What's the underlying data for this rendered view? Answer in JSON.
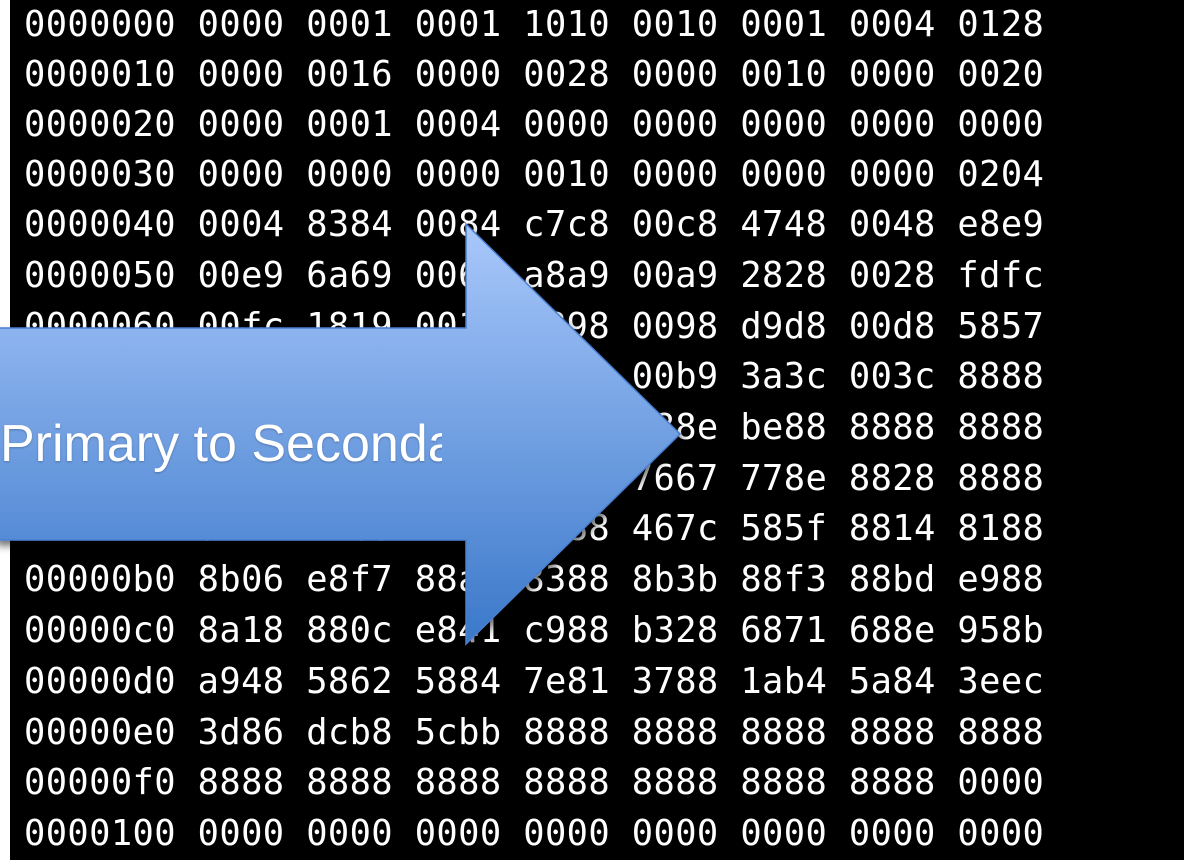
{
  "hex_dump": {
    "lines": [
      "0000000 0000 0001 0001 1010 0010 0001 0004 0128",
      "0000010 0000 0016 0000 0028 0000 0010 0000 0020",
      "0000020 0000 0001 0004 0000 0000 0000 0000 0000",
      "0000030 0000 0000 0000 0010 0000 0000 0000 0204",
      "0000040 0004 8384 0084 c7c8 00c8 4748 0048 e8e9",
      "0000050 00e9 6a69 0069 a8a9 00a9 2828 0028 fdfc",
      "0000060 00fc 1819 0019 9898 0098 d9d8 00d8 5857",
      "0000070 0057 7b7a 007a b9b9 00b9 3a3c 003c 8888",
      "0000080 8888 8888 8888 8888 288e be88 8888 8888",
      "0000090 3b83 8867 7a88 7688 7667 778e 8828 8888",
      "00000a0 d61f 7abd 8888 8888 467c 585f 8814 8188",
      "00000b0 8b06 e8f7 88aa 8388 8b3b 88f3 88bd e988",
      "00000c0 8a18 880c e841 c988 b328 6871 688e 958b",
      "00000d0 a948 5862 5884 7e81 3788 1ab4 5a84 3eec",
      "00000e0 3d86 dcb8 5cbb 8888 8888 8888 8888 8888",
      "00000f0 8888 8888 8888 8888 8888 8888 8888 0000",
      "0000100 0000 0000 0000 0000 0000 0000 0000 0000"
    ]
  },
  "arrow": {
    "label": "Primary to Secondary"
  },
  "colors": {
    "background": "#000000",
    "text": "#ffffff",
    "arrow_light": "#a9c8fb",
    "arrow_dark": "#3a78c9",
    "arrow_outline": "#4a7fd0"
  }
}
